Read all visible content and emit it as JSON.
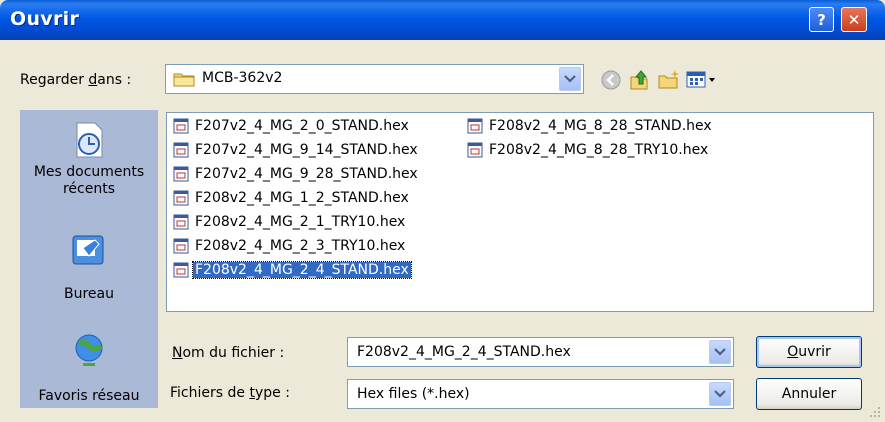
{
  "window": {
    "title": "Ouvrir",
    "help_label": "?",
    "close_label": "✕"
  },
  "lookin": {
    "label_pre": "Regarder ",
    "label_accel": "d",
    "label_post": "ans :",
    "value": "MCB-362v2"
  },
  "toolbar": [
    "back-icon",
    "up-folder-icon",
    "new-folder-icon",
    "view-menu-icon"
  ],
  "places": [
    {
      "label": "Mes documents récents",
      "icon": "recent-documents-icon"
    },
    {
      "label": "Bureau",
      "icon": "desktop-icon"
    },
    {
      "label": "Favoris réseau",
      "icon": "network-places-icon"
    }
  ],
  "files": [
    "F207v2_4_MG_2_0_STAND.hex",
    "F207v2_4_MG_9_14_STAND.hex",
    "F207v2_4_MG_9_28_STAND.hex",
    "F208v2_4_MG_1_2_STAND.hex",
    "F208v2_4_MG_2_1_TRY10.hex",
    "F208v2_4_MG_2_3_TRY10.hex",
    "F208v2_4_MG_2_4_STAND.hex",
    "F208v2_4_MG_8_28_STAND.hex",
    "F208v2_4_MG_8_28_TRY10.hex"
  ],
  "selected_file": "F208v2_4_MG_2_4_STAND.hex",
  "filename": {
    "label_accel": "N",
    "label_rest": "om du fichier :",
    "value": "F208v2_4_MG_2_4_STAND.hex"
  },
  "filetype": {
    "label_pre": "Fichiers de ",
    "label_accel": "t",
    "label_post": "ype :",
    "value": "Hex files (*.hex)"
  },
  "buttons": {
    "open_accel": "O",
    "open_rest": "uvrir",
    "cancel": "Annuler"
  },
  "colors": {
    "titlebar": "#0058e6",
    "selection": "#316ac5",
    "places_bg": "#a9b9d6",
    "dialog_bg": "#ece9d8"
  }
}
